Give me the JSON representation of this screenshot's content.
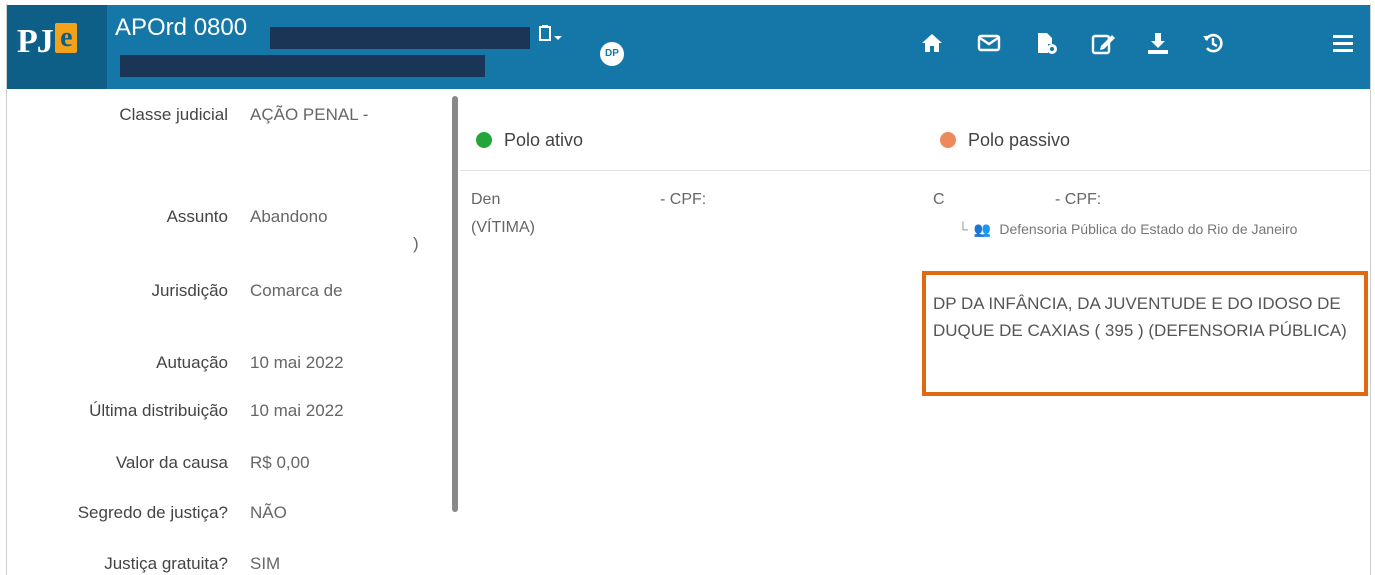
{
  "header": {
    "logo_text": "PJ",
    "logo_e": "e",
    "process_title": "APOrd 0800",
    "clipboard_icon": "clipboard-icon",
    "dp_badge": "DP",
    "icons": [
      "home-icon",
      "mail-icon",
      "document-settings-icon",
      "edit-icon",
      "download-icon",
      "history-icon",
      "menu-icon"
    ]
  },
  "details": {
    "fields": [
      {
        "label": "Classe judicial",
        "value": "AÇÃO PENAL -"
      },
      {
        "label": "Assunto",
        "value": "Abandono"
      },
      {
        "label": "Jurisdição",
        "value": "Comarca de"
      },
      {
        "label": "Autuação",
        "value": "10 mai 2022"
      },
      {
        "label": "Última distribuição",
        "value": "10 mai 2022"
      },
      {
        "label": "Valor da causa",
        "value": "R$ 0,00"
      },
      {
        "label": "Segredo de justiça?",
        "value": "NÃO"
      },
      {
        "label": "Justiça gratuita?",
        "value": "SIM"
      }
    ],
    "assunto_tail": ")"
  },
  "parties": {
    "active": {
      "title": "Polo ativo",
      "color": "#22a63a",
      "name": "Den",
      "cpf_label": "- CPF:",
      "role": "(VÍTIMA)"
    },
    "passive": {
      "title": "Polo passivo",
      "color": "#ec8a5b",
      "name": "C",
      "cpf_label": "- CPF:",
      "representative": "Defensoria Pública do Estado do Rio de Janeiro",
      "office": "DP DA INFÂNCIA, DA JUVENTUDE E DO IDOSO DE DUQUE DE CAXIAS ( 395 ) (DEFENSORIA PÚBLICA)"
    }
  }
}
